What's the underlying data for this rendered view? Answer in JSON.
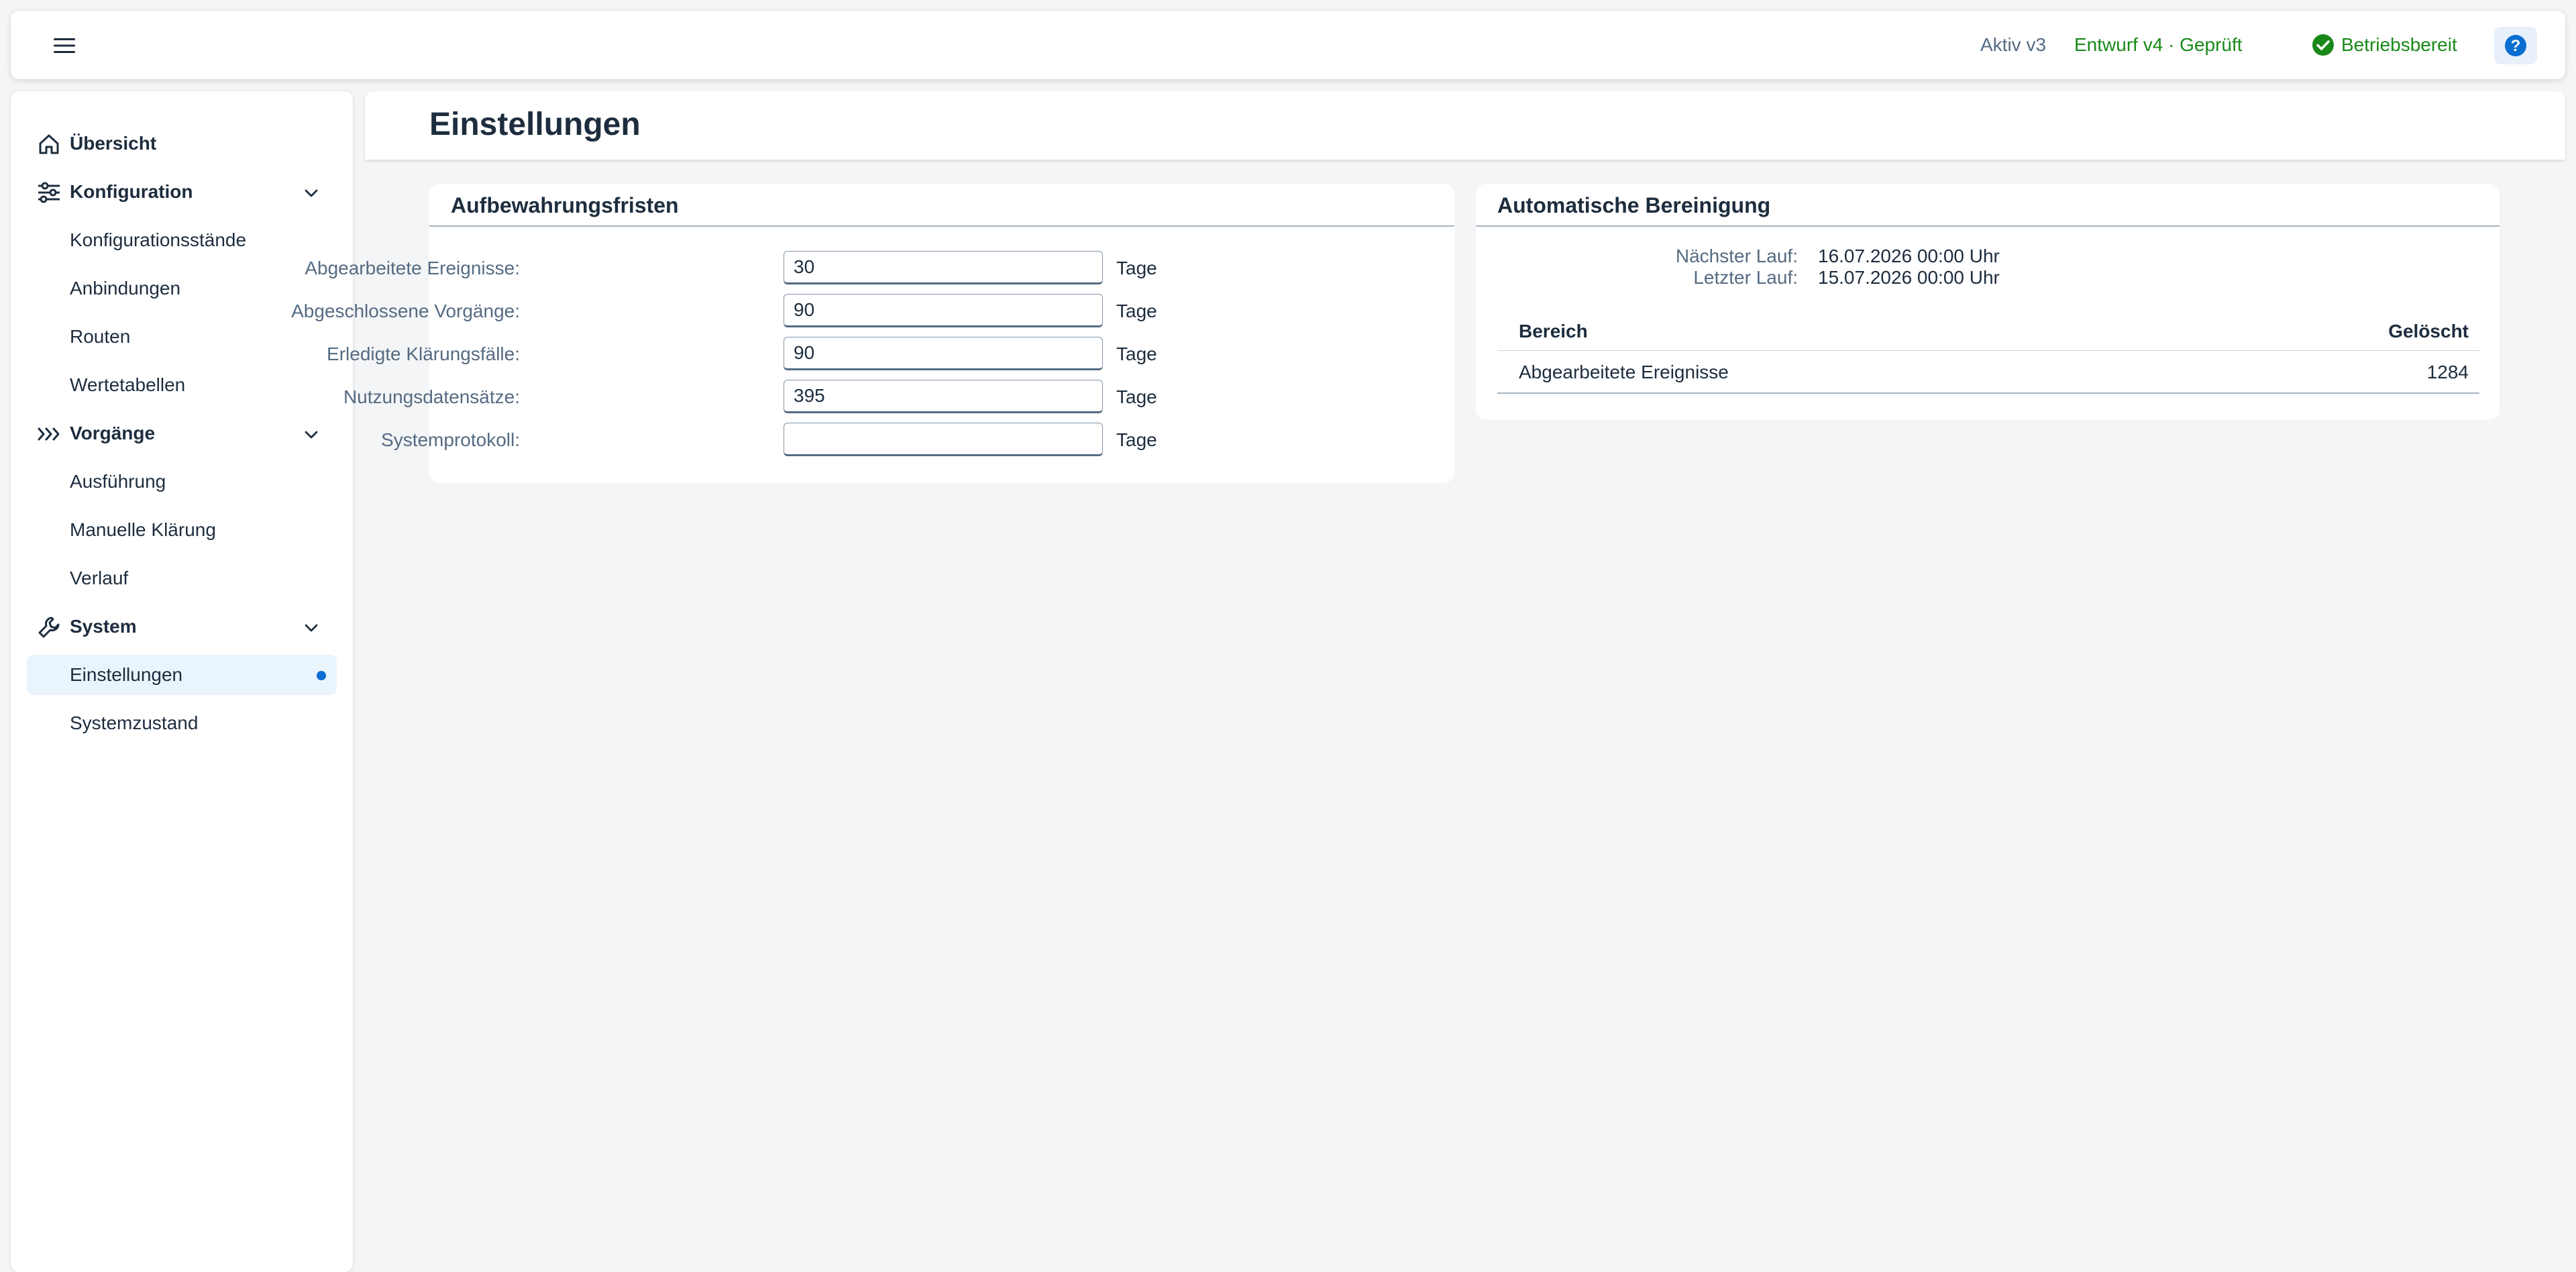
{
  "header": {
    "menu_icon": "hamburger-menu-icon",
    "active_version": "Aktiv v3",
    "draft_version": "Entwurf v4 · Geprüft",
    "status": "Betriebsbereit",
    "status_icon": "check-circle-icon",
    "help_icon": "help-question-icon",
    "status_color": "#188918",
    "accent_color": "#0a6ed1"
  },
  "sidebar": {
    "items": [
      {
        "label": "Übersicht",
        "icon": "home-icon",
        "level": 0
      },
      {
        "label": "Konfiguration",
        "icon": "sliders-icon",
        "level": 0,
        "expanded": true
      },
      {
        "label": "Konfigurationsstände",
        "level": 1
      },
      {
        "label": "Anbindungen",
        "level": 1
      },
      {
        "label": "Routen",
        "level": 1
      },
      {
        "label": "Wertetabellen",
        "level": 1
      },
      {
        "label": "Vorgänge",
        "icon": "process-chevrons-icon",
        "level": 0,
        "expanded": true
      },
      {
        "label": "Ausführung",
        "level": 1
      },
      {
        "label": "Manuelle Klärung",
        "level": 1
      },
      {
        "label": "Verlauf",
        "level": 1
      },
      {
        "label": "System",
        "icon": "wrench-icon",
        "level": 0,
        "expanded": true
      },
      {
        "label": "Einstellungen",
        "level": 1,
        "selected": true
      },
      {
        "label": "Systemzustand",
        "level": 1
      }
    ]
  },
  "page": {
    "title": "Einstellungen"
  },
  "retention": {
    "title": "Aufbewahrungsfristen",
    "unit": "Tage",
    "fields": [
      {
        "label": "Abgearbeitete Ereignisse:",
        "value": "30"
      },
      {
        "label": "Abgeschlossene Vorgänge:",
        "value": "90"
      },
      {
        "label": "Erledigte Klärungsfälle:",
        "value": "90"
      },
      {
        "label": "Nutzungsdatensätze:",
        "value": "395"
      },
      {
        "label": "Systemprotokoll:",
        "value": ""
      }
    ]
  },
  "cleanup": {
    "title": "Automatische Bereinigung",
    "next_run_label": "Nächster Lauf:",
    "next_run_value": "16.07.2026 00:00 Uhr",
    "last_run_label": "Letzter Lauf:",
    "last_run_value": "15.07.2026 00:00 Uhr",
    "table": {
      "headers": [
        "Bereich",
        "Gelöscht"
      ],
      "rows": [
        [
          "Abgearbeitete Ereignisse",
          "1284"
        ]
      ]
    }
  }
}
